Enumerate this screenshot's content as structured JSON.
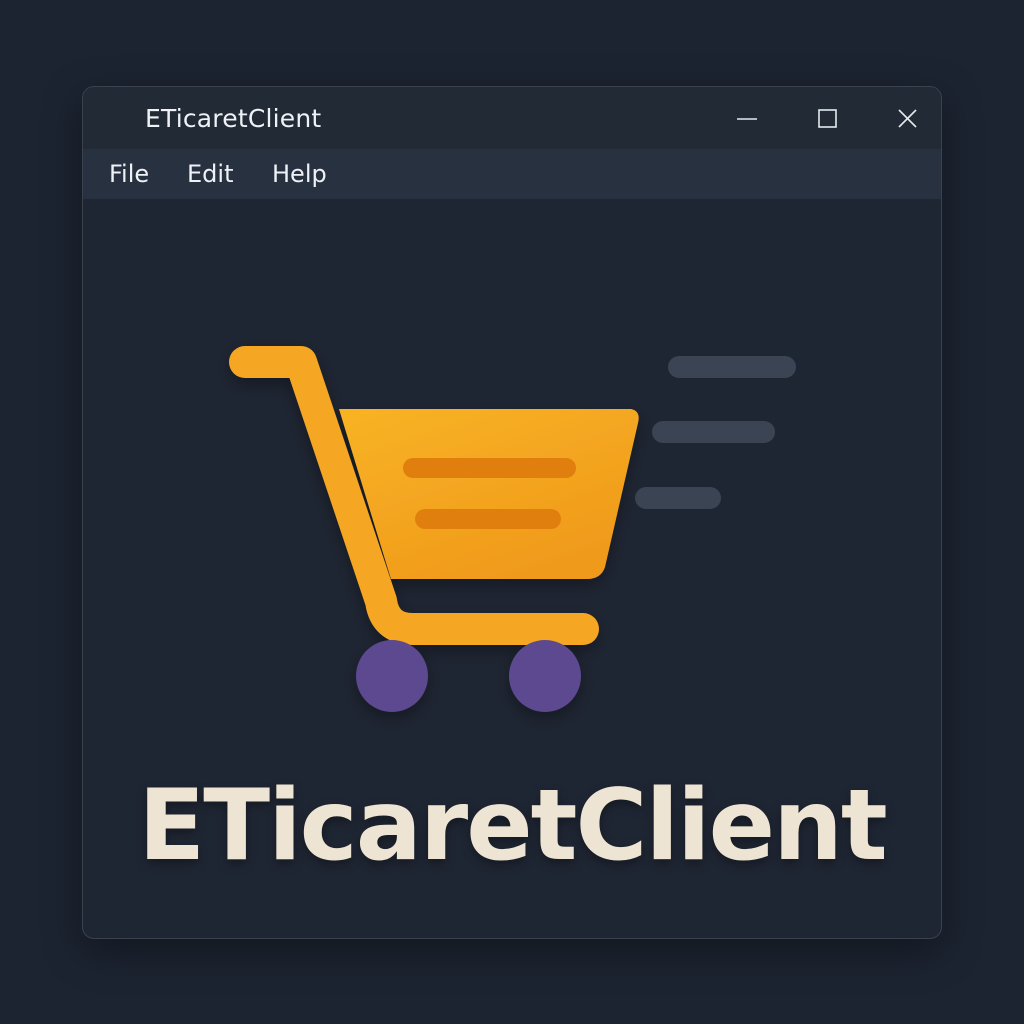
{
  "window": {
    "title": "ETicaretClient"
  },
  "menu": {
    "items": [
      "File",
      "Edit",
      "Help"
    ]
  },
  "content": {
    "app_name": "ETicaretClient",
    "logo_icon": "shopping-cart-icon"
  },
  "colors": {
    "background": "#1c2431",
    "window": "#1f2633",
    "menubar": "#283140",
    "cart_orange": "#f5a623",
    "cart_wheels": "#5b4a8f",
    "speed_lines": "#3b4452",
    "app_name_text": "#ede4d3"
  }
}
